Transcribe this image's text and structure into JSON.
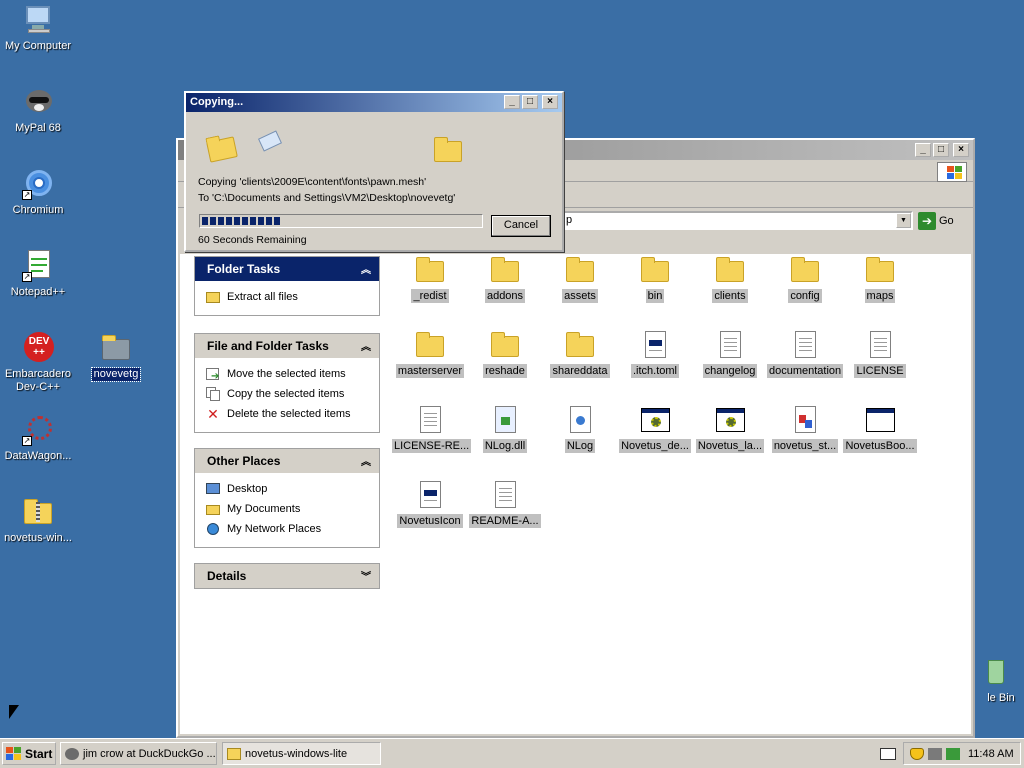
{
  "desktop": {
    "icons": [
      {
        "label": "My Computer"
      },
      {
        "label": "MyPal 68"
      },
      {
        "label": "Chromium"
      },
      {
        "label": "Notepad++"
      },
      {
        "label": "Embarcadero Dev-C++"
      },
      {
        "label": "DataWagon..."
      },
      {
        "label": "novetus-win..."
      },
      {
        "label": "novevetg"
      },
      {
        "label": "le Bin"
      }
    ]
  },
  "explorer": {
    "address_fragment": "p",
    "go_label": "Go",
    "task_panes": [
      {
        "title": "Folder Tasks",
        "items": [
          "Extract all files"
        ]
      },
      {
        "title": "File and Folder Tasks",
        "items": [
          "Move the selected items",
          "Copy the selected items",
          "Delete the selected items"
        ]
      },
      {
        "title": "Other Places",
        "items": [
          "Desktop",
          "My Documents",
          "My Network Places"
        ]
      },
      {
        "title": "Details",
        "items": []
      }
    ],
    "files": [
      {
        "name": "_redist",
        "type": "folder"
      },
      {
        "name": "addons",
        "type": "folder"
      },
      {
        "name": "assets",
        "type": "folder"
      },
      {
        "name": "bin",
        "type": "folder"
      },
      {
        "name": "clients",
        "type": "folder"
      },
      {
        "name": "config",
        "type": "folder"
      },
      {
        "name": "maps",
        "type": "folder"
      },
      {
        "name": "masterserver",
        "type": "folder"
      },
      {
        "name": "reshade",
        "type": "folder"
      },
      {
        "name": "shareddata",
        "type": "folder"
      },
      {
        "name": ".itch.toml",
        "type": "file"
      },
      {
        "name": "changelog",
        "type": "text"
      },
      {
        "name": "documentation",
        "type": "text"
      },
      {
        "name": "LICENSE",
        "type": "text"
      },
      {
        "name": "LICENSE-RE...",
        "type": "text"
      },
      {
        "name": "NLog.dll",
        "type": "dll"
      },
      {
        "name": "NLog",
        "type": "xml"
      },
      {
        "name": "Novetus_de...",
        "type": "app"
      },
      {
        "name": "Novetus_la...",
        "type": "app"
      },
      {
        "name": "novetus_st...",
        "type": "media"
      },
      {
        "name": "NovetusBoo...",
        "type": "window"
      },
      {
        "name": "NovetusIcon",
        "type": "file"
      },
      {
        "name": "README-A...",
        "type": "text"
      }
    ]
  },
  "dialog": {
    "title": "Copying...",
    "copying_line": "Copying 'clients\\2009E\\content\\fonts\\pawn.mesh'",
    "to_line": "To 'C:\\Documents and Settings\\VM2\\Desktop\\novevetg'",
    "remaining": "60 Seconds Remaining",
    "cancel_label": "Cancel",
    "progress": 0.28
  },
  "taskbar": {
    "start_label": "Start",
    "buttons": [
      "jim crow at DuckDuckGo ...",
      "novetus-windows-lite"
    ],
    "clock": "11:48 AM"
  },
  "colors": {
    "desktop": "#3a6ea5",
    "title_active": "#0a246a",
    "folder": "#f5d35a"
  }
}
